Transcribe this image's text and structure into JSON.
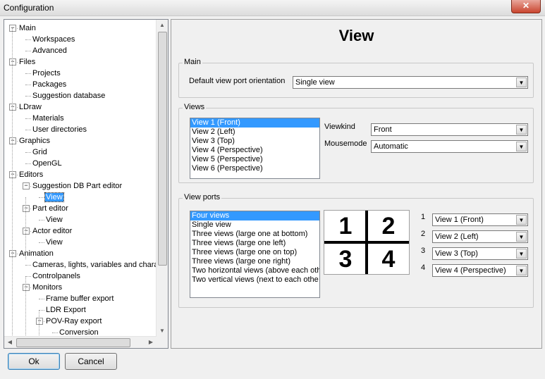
{
  "window": {
    "title": "Configuration",
    "close_glyph": "✕"
  },
  "tree": {
    "nodes": [
      {
        "label": "Main",
        "level": 0,
        "exp": "−"
      },
      {
        "label": "Workspaces",
        "level": 1
      },
      {
        "label": "Advanced",
        "level": 1
      },
      {
        "label": "Files",
        "level": 0,
        "exp": "−"
      },
      {
        "label": "Projects",
        "level": 1
      },
      {
        "label": "Packages",
        "level": 1
      },
      {
        "label": "Suggestion database",
        "level": 1
      },
      {
        "label": "LDraw",
        "level": 0,
        "exp": "−"
      },
      {
        "label": "Materials",
        "level": 1
      },
      {
        "label": "User directories",
        "level": 1
      },
      {
        "label": "Graphics",
        "level": 0,
        "exp": "−"
      },
      {
        "label": "Grid",
        "level": 1
      },
      {
        "label": "OpenGL",
        "level": 1
      },
      {
        "label": "Editors",
        "level": 0,
        "exp": "−"
      },
      {
        "label": "Suggestion DB Part editor",
        "level": 1,
        "exp": "−"
      },
      {
        "label": "View",
        "level": 2,
        "selected": true
      },
      {
        "label": "Part editor",
        "level": 1,
        "exp": "−"
      },
      {
        "label": "View",
        "level": 2
      },
      {
        "label": "Actor editor",
        "level": 1,
        "exp": "−"
      },
      {
        "label": "View",
        "level": 2
      },
      {
        "label": "Animation",
        "level": 0,
        "exp": "−"
      },
      {
        "label": "Cameras, lights, variables and chara",
        "level": 1
      },
      {
        "label": "Controlpanels",
        "level": 1
      },
      {
        "label": "Monitors",
        "level": 1,
        "exp": "−"
      },
      {
        "label": "Frame buffer export",
        "level": 2
      },
      {
        "label": "LDR Export",
        "level": 2
      },
      {
        "label": "POV-Ray export",
        "level": 2,
        "exp": "−"
      },
      {
        "label": "Conversion",
        "level": 3
      }
    ],
    "scroll_up": "▲",
    "scroll_down": "▼",
    "scroll_left": "◀",
    "scroll_right": "▶"
  },
  "page": {
    "title": "View"
  },
  "main_group": {
    "legend": "Main",
    "orientation_label": "Default view port orientation",
    "orientation_value": "Single view"
  },
  "views_group": {
    "legend": "Views",
    "list": [
      "View 1 (Front)",
      "View 2 (Left)",
      "View 3 (Top)",
      "View 4 (Perspective)",
      "View 5 (Perspective)",
      "View 6 (Perspective)"
    ],
    "viewkind_label": "Viewkind",
    "viewkind_value": "Front",
    "mousemode_label": "Mousemode",
    "mousemode_value": "Automatic"
  },
  "viewports_group": {
    "legend": "View ports",
    "list": [
      "Four views",
      "Single view",
      "Three views (large one at bottom)",
      "Three views (large one left)",
      "Three views (large one on top)",
      "Three views (large one right)",
      "Two horizontal views (above each oth",
      "Two vertical views (next to each othe"
    ],
    "preview_numbers": [
      "1",
      "2",
      "3",
      "4"
    ],
    "slots": [
      {
        "num": "1",
        "value": "View 1 (Front)"
      },
      {
        "num": "2",
        "value": "View 2 (Left)"
      },
      {
        "num": "3",
        "value": "View 3 (Top)"
      },
      {
        "num": "4",
        "value": "View 4 (Perspective)"
      }
    ]
  },
  "buttons": {
    "ok": "Ok",
    "cancel": "Cancel"
  },
  "colors": {
    "selection": "#3399ff"
  },
  "dropdown_glyph": "▼"
}
